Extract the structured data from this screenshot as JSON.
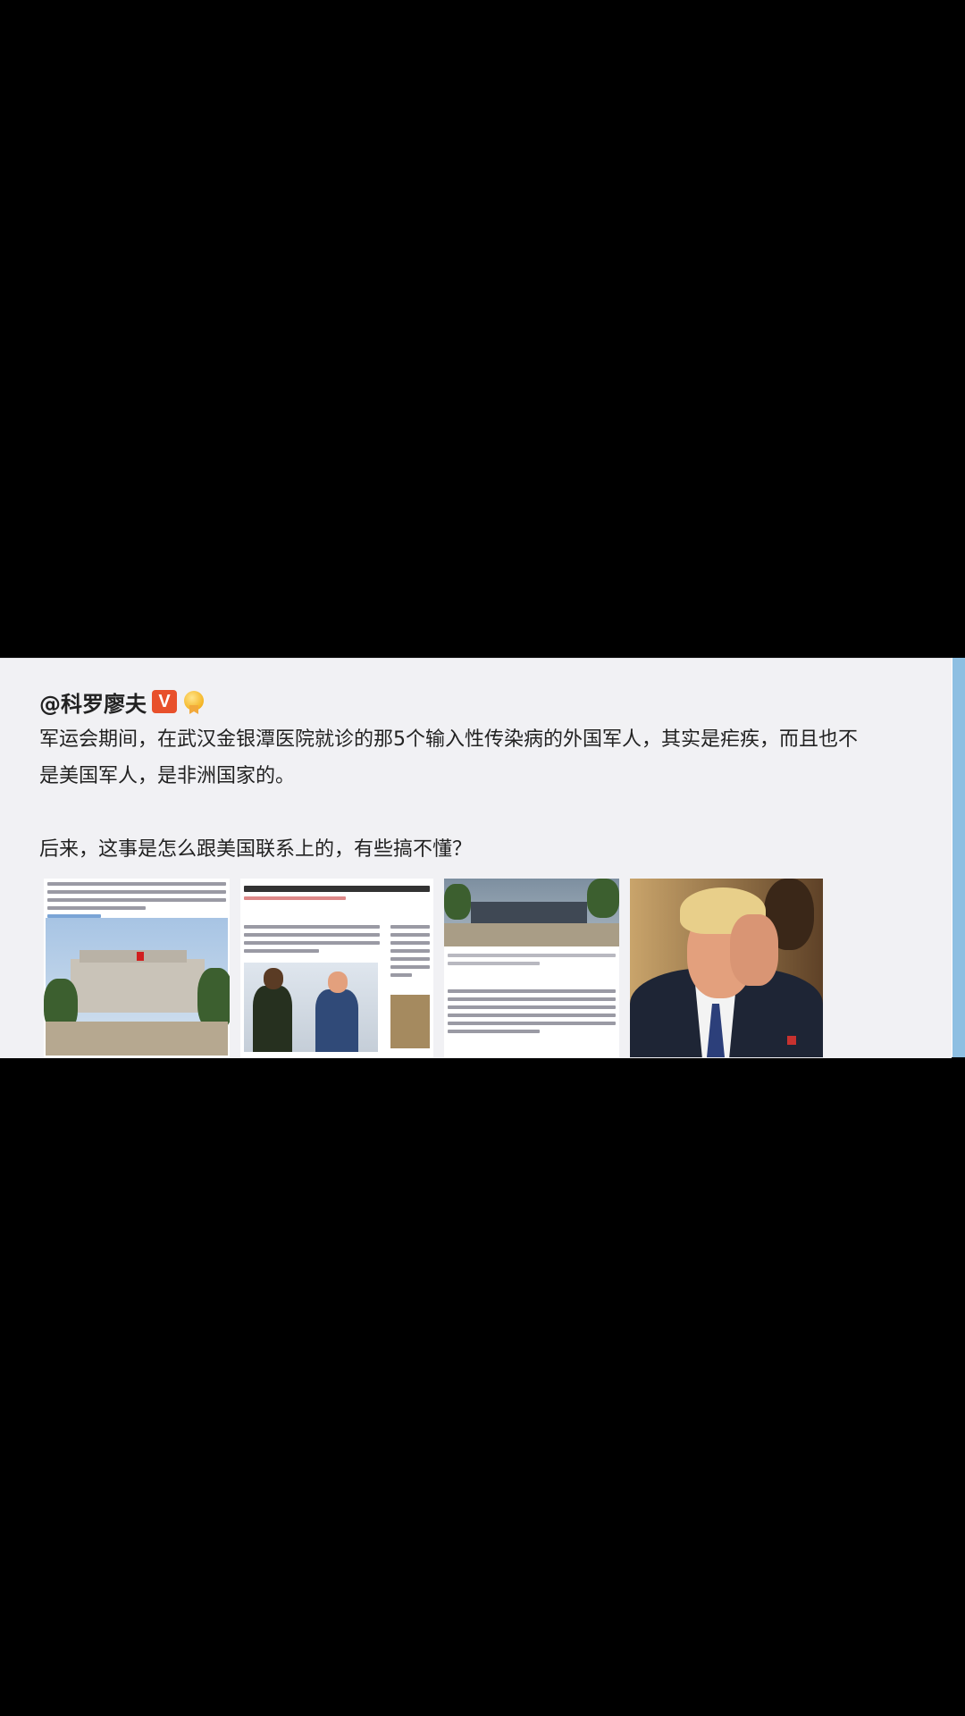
{
  "post": {
    "author": "@科罗廖夫",
    "verified_badge": "V",
    "text_lines": [
      "军运会期间，在武汉金银潭医院就诊的那5个输入性传染病的外国军人，其实是疟疾，而且也不",
      "是美国军人，是非洲国家的。",
      "后来，这事是怎么跟美国联系上的，有些搞不懂？"
    ],
    "images": [
      {
        "label": "news-article-hospital-photo"
      },
      {
        "label": "news-article-handshake-photo"
      },
      {
        "label": "news-article-quote"
      },
      {
        "label": "portrait-photo"
      }
    ]
  },
  "colors": {
    "card_bg": "#f1f1f4",
    "scroll_rail": "#8ebfe2",
    "badge": "#e8502b"
  }
}
